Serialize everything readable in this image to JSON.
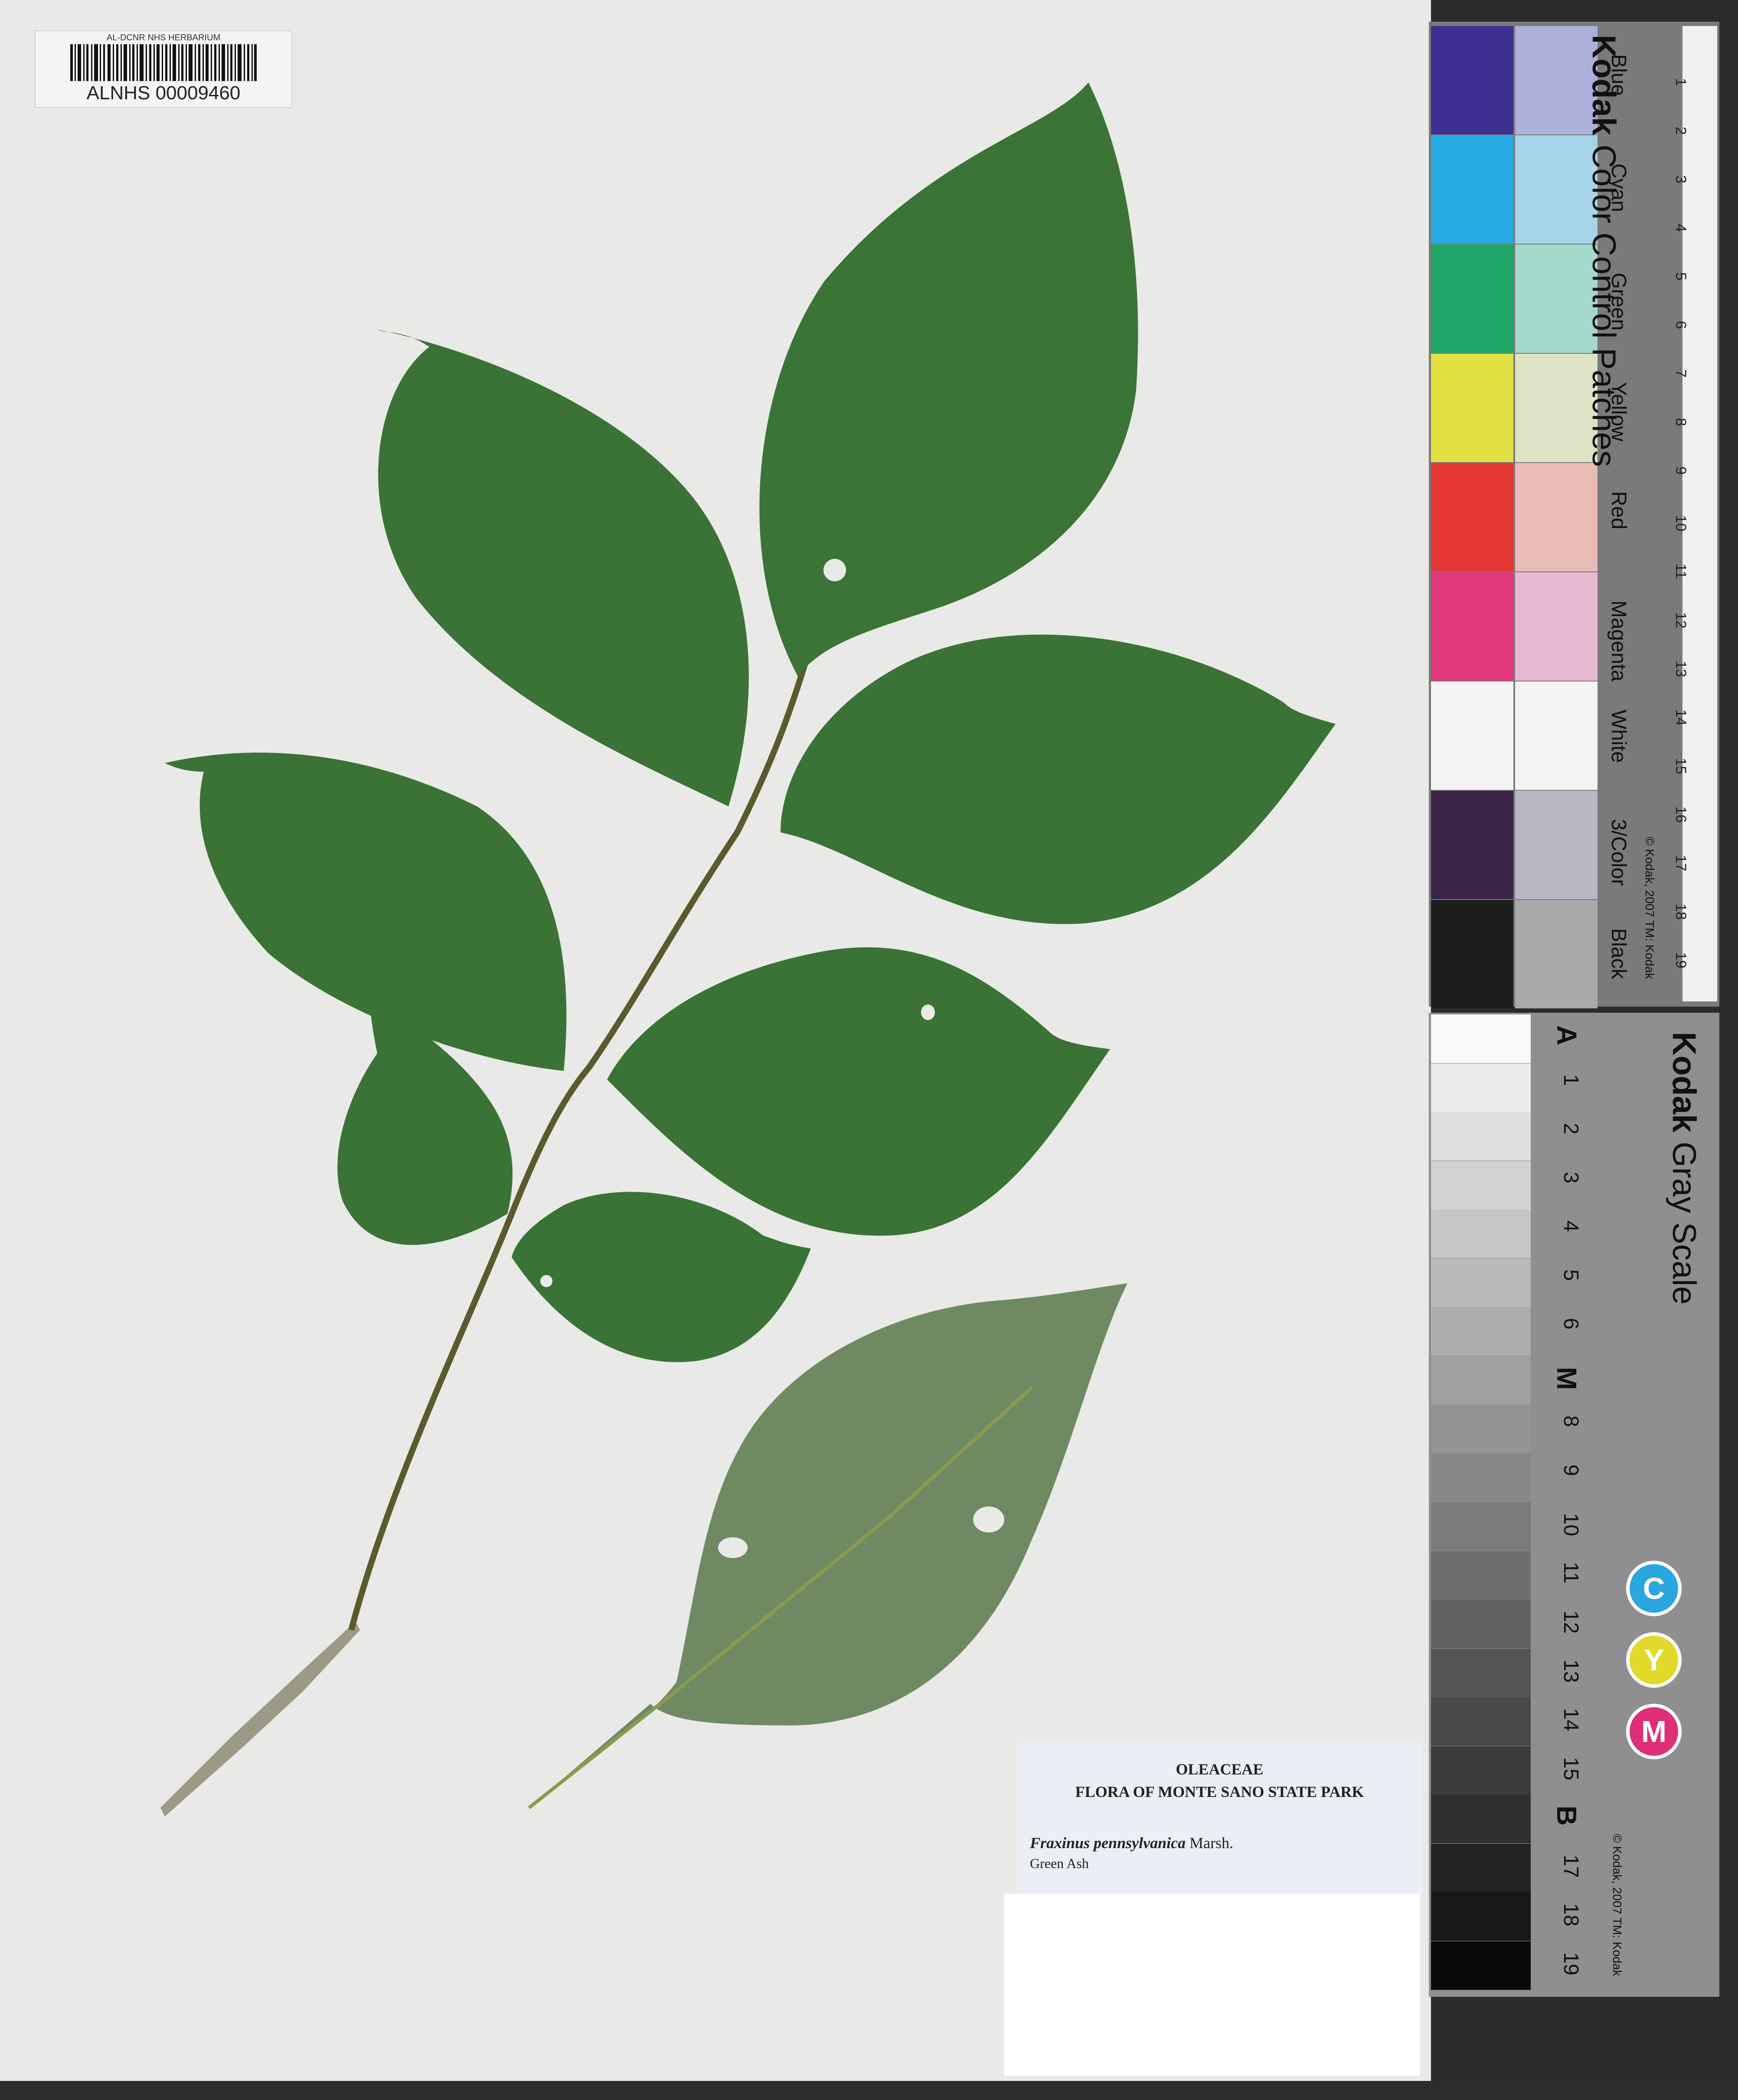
{
  "barcode": {
    "header": "AL-DCNR NHS HERBARIUM",
    "number": "ALNHS 00009460"
  },
  "label": {
    "family": "OLEACEAE",
    "flora": "FLORA OF MONTE SANO STATE PARK",
    "species": "Fraxinus pennsylvanica",
    "author": "Marsh.",
    "common_name": "Green Ash"
  },
  "color_card": {
    "brand": "Kodak",
    "title": "Color Control Patches",
    "patches": [
      {
        "name": "Blue",
        "dark": "#3c2f8f",
        "light": "#aeb0dc"
      },
      {
        "name": "Cyan",
        "dark": "#27a9e3",
        "light": "#a6d4e8"
      },
      {
        "name": "Green",
        "dark": "#1ea568",
        "light": "#a4d9cc"
      },
      {
        "name": "Yellow",
        "dark": "#e3e044",
        "light": "#dfe3c6"
      },
      {
        "name": "Red",
        "dark": "#e23733",
        "light": "#eabcb6"
      },
      {
        "name": "Magenta",
        "dark": "#e0367b",
        "light": "#e8b9d0"
      },
      {
        "name": "White",
        "dark": "#f3f3f1",
        "light": "#f3f3f1"
      },
      {
        "name": "3/Color",
        "dark": "#3a2448",
        "light": "#b8b8c4"
      },
      {
        "name": "Black",
        "dark": "#1d1d1e",
        "light": "#a9a9aa"
      }
    ],
    "copyright": "© Kodak, 2007 TM: Kodak",
    "ruler_numbers": [
      "1",
      "2",
      "3",
      "4",
      "5",
      "6",
      "7",
      "8",
      "9",
      "10",
      "11",
      "12",
      "13",
      "14",
      "15",
      "16",
      "17",
      "18",
      "19"
    ]
  },
  "gray_card": {
    "brand": "Kodak",
    "title": "Gray Scale",
    "steps": [
      "A",
      "1",
      "2",
      "3",
      "4",
      "5",
      "6",
      "M",
      "8",
      "9",
      "10",
      "11",
      "12",
      "13",
      "14",
      "15",
      "B",
      "17",
      "18",
      "19"
    ],
    "cym": [
      {
        "letter": "C",
        "color": "#2aa7e0"
      },
      {
        "letter": "Y",
        "color": "#e2d92a"
      },
      {
        "letter": "M",
        "color": "#dc2f76"
      }
    ],
    "copyright": "© Kodak, 2007 TM: Kodak"
  }
}
